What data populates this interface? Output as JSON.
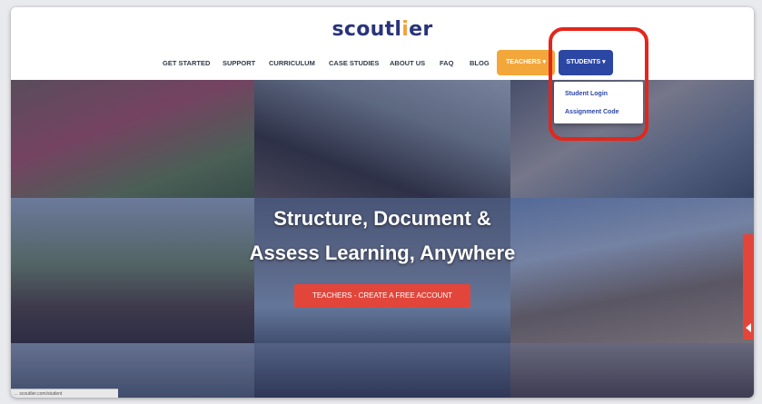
{
  "header": {
    "logo_pre": "scoutl",
    "logo_accent": "i",
    "logo_post": "er"
  },
  "nav": {
    "items": [
      "GET STARTED",
      "SUPPORT",
      "CURRICULUM",
      "CASE STUDIES",
      "ABOUT US",
      "FAQ",
      "BLOG"
    ],
    "teachers_label": "TEACHERS ▾",
    "students_label": "STUDENTS ▾"
  },
  "students_menu": {
    "items": [
      "Student Login",
      "Assignment Code"
    ]
  },
  "hero": {
    "title_line1": "Structure, Document &",
    "title_line2": "Assess Learning, Anywhere",
    "cta_label": "TEACHERS - CREATE A FREE ACCOUNT"
  },
  "status_bar": {
    "text": "… scoutlier.com/student"
  },
  "colors": {
    "brand_navy": "#29347a",
    "teachers_orange": "#f3a73a",
    "students_blue": "#2b46a3",
    "cta_red": "#e2463b",
    "highlight_red": "#e3261b"
  }
}
